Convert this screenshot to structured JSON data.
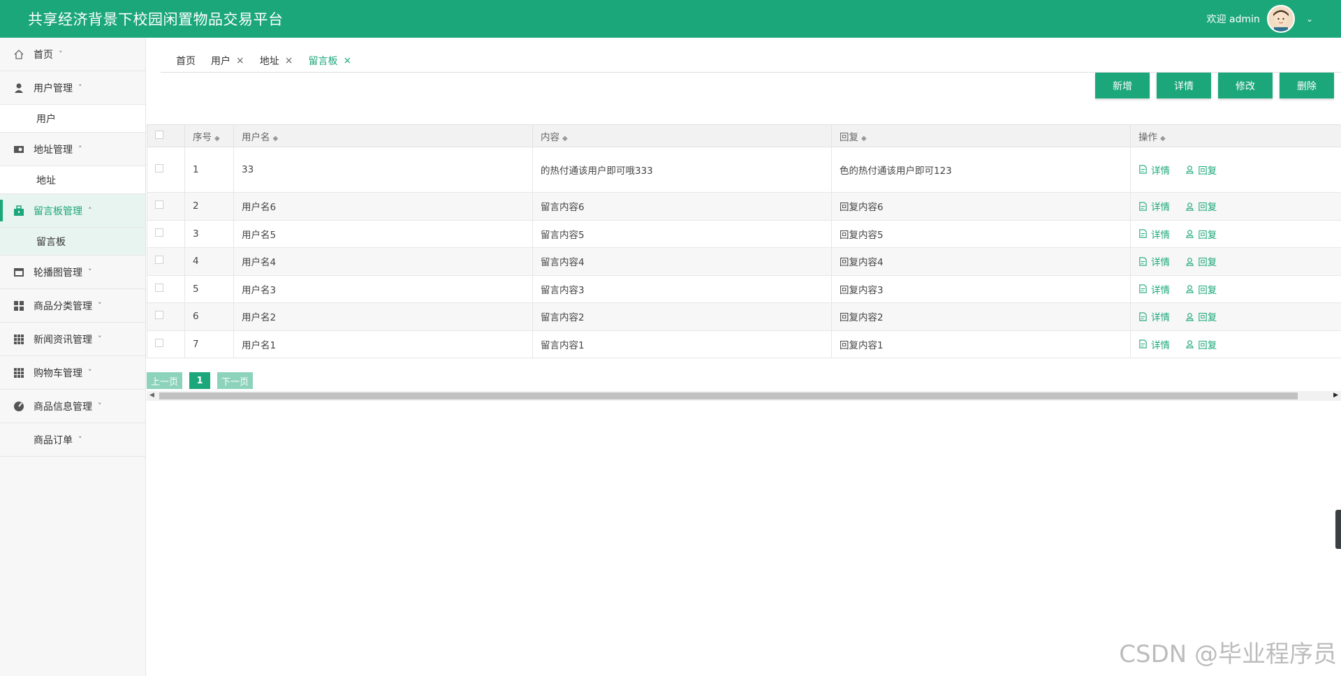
{
  "header": {
    "title": "共享经济背景下校园闲置物品交易平台",
    "welcome": "欢迎 admin"
  },
  "sidebar": {
    "items": [
      {
        "label": "首页",
        "arrow": "˅"
      },
      {
        "label": "用户管理",
        "arrow": "˄",
        "sub": "用户"
      },
      {
        "label": "地址管理",
        "arrow": "˄",
        "sub": "地址"
      },
      {
        "label": "留言板管理",
        "arrow": "˄",
        "sub": "留言板"
      },
      {
        "label": "轮播图管理",
        "arrow": "˅"
      },
      {
        "label": "商品分类管理",
        "arrow": "˅"
      },
      {
        "label": "新闻资讯管理",
        "arrow": "˅"
      },
      {
        "label": "购物车管理",
        "arrow": "˅"
      },
      {
        "label": "商品信息管理",
        "arrow": "˅"
      },
      {
        "label": "商品订单",
        "arrow": "˅"
      }
    ]
  },
  "tabs": [
    {
      "label": "首页"
    },
    {
      "label": "用户",
      "close": "×"
    },
    {
      "label": "地址",
      "close": "×"
    },
    {
      "label": "留言板",
      "close": "×"
    }
  ],
  "toolbar": {
    "add": "新增",
    "detail": "详情",
    "edit": "修改",
    "delete": "删除"
  },
  "table": {
    "headers": [
      "序号",
      "用户名",
      "内容",
      "回复",
      "操作"
    ],
    "sort_icon": "◆",
    "actions": {
      "detail": "详情",
      "reply": "回复"
    },
    "rows": [
      [
        "1",
        "33",
        "的热付通该用户即可哦333",
        "色的热付通该用户即可123"
      ],
      [
        "2",
        "用户名6",
        "留言内容6",
        "回复内容6"
      ],
      [
        "3",
        "用户名5",
        "留言内容5",
        "回复内容5"
      ],
      [
        "4",
        "用户名4",
        "留言内容4",
        "回复内容4"
      ],
      [
        "5",
        "用户名3",
        "留言内容3",
        "回复内容3"
      ],
      [
        "6",
        "用户名2",
        "留言内容2",
        "回复内容2"
      ],
      [
        "7",
        "用户名1",
        "留言内容1",
        "回复内容1"
      ]
    ]
  },
  "pager": {
    "prev": "上一页",
    "page": "1",
    "next": "下一页"
  },
  "watermark": "CSDN @毕业程序员",
  "colors": {
    "accent": "#1ba77a",
    "accent_light": "#8dd3bc"
  },
  "icons": [
    "home-icon",
    "user-icon",
    "address-icon",
    "message-board-icon",
    "carousel-icon",
    "category-icon",
    "news-icon",
    "cart-icon",
    "product-icon"
  ]
}
